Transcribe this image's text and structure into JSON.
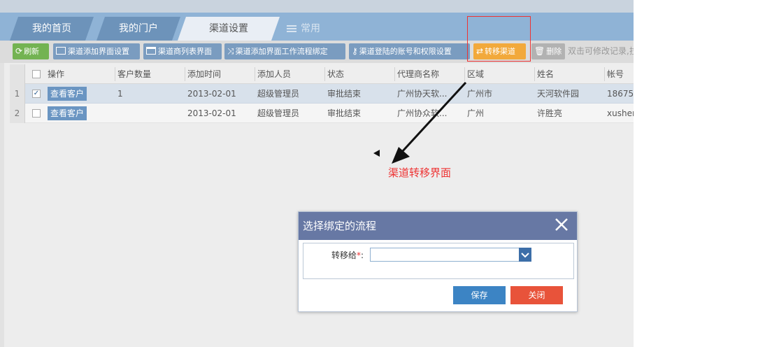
{
  "tabs": [
    {
      "label": "我的首页"
    },
    {
      "label": "我的门户"
    },
    {
      "label": "渠道设置"
    },
    {
      "label": "常用"
    }
  ],
  "toolbar": {
    "refresh": "刷新",
    "add_ui": "渠道添加界面设置",
    "list_ui": "渠道商列表界面",
    "workflow_bind": "渠道添加界面工作流程绑定",
    "login_account": "渠道登陆的账号和权限设置",
    "transfer": "转移渠道",
    "delete": "删除",
    "hint": "双击可修改记录,拉"
  },
  "grid": {
    "columns": [
      "操作",
      "客户数量",
      "添加时间",
      "添加人员",
      "状态",
      "代理商名称",
      "区域",
      "姓名",
      "帐号"
    ],
    "rows": [
      {
        "num": "1",
        "checked": "✓",
        "action": "查看客户",
        "count": "1",
        "time": "2013-02-01",
        "person": "超级管理员",
        "status": "审批结束",
        "agent": "广州协天软...",
        "region": "广州市",
        "name": "天河软件园",
        "account": "18675"
      },
      {
        "num": "2",
        "checked": "",
        "action": "查看客户",
        "count": "",
        "time": "2013-02-01",
        "person": "超级管理员",
        "status": "审批结束",
        "agent": "广州协众软...",
        "region": "广州",
        "name": "许胜亮",
        "account": "xushen"
      }
    ]
  },
  "annotation": {
    "caption": "渠道转移界面",
    "color": "#ee3333"
  },
  "dialog": {
    "title": "选择绑定的流程",
    "field_label": "转移给",
    "required_mark": "*",
    "colon": ":",
    "field_value": "",
    "save": "保存",
    "close": "关闭"
  },
  "colors": {
    "tab_active": "#e9eef5",
    "toolbar_bg": "#dcdcdc",
    "dialog_header": "#6778a4",
    "save": "#3c84c4",
    "close": "#e8533a",
    "transfer": "#f2a93b"
  }
}
